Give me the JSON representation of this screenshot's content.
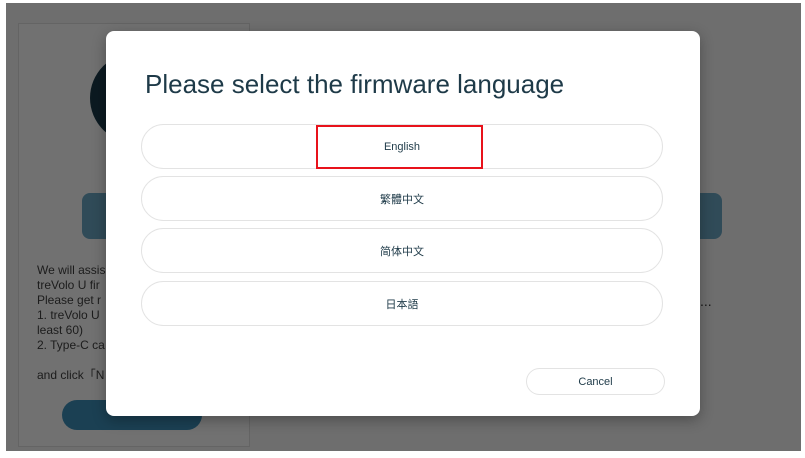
{
  "background": {
    "intro_text": "We will assis\ntreVolo U fir\nPlease get r\n1. treVolo U\nleast 60)\n2. Type-C ca\n\nand click「N",
    "ellipsis": "..."
  },
  "dialog": {
    "title": "Please select the firmware language",
    "options": [
      {
        "label": "English"
      },
      {
        "label": "繁體中文"
      },
      {
        "label": "简体中文"
      },
      {
        "label": "日本語"
      }
    ],
    "cancel_label": "Cancel",
    "highlight_color": "#e8121b"
  }
}
